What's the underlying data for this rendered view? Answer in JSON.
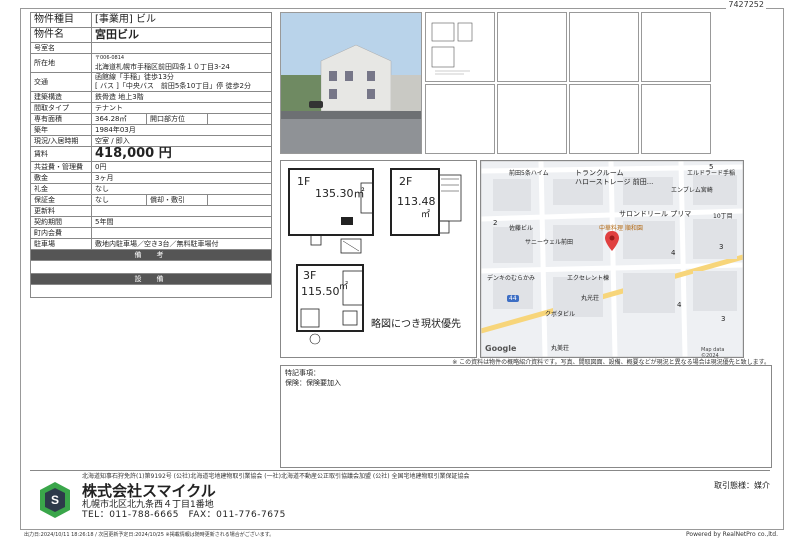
{
  "doc_id": "7427252",
  "property": {
    "type_label": "物件種目",
    "type_value": "[事業用] ビル",
    "name_label": "物件名",
    "name_value": "宮田ビル",
    "room_label": "号室名",
    "room_value": "",
    "location_label": "所在地",
    "postal": "〒006-0814",
    "address": "北海道札幌市手稲区前田四条１０丁目3-24",
    "traffic_label": "交通",
    "traffic_line1": "函館線「手稲」徒歩13分",
    "traffic_line2": "[ バス ]「中央バス　前田5条10丁目」停 徒歩2分",
    "structure_label": "建築構造",
    "structure_value": "鉄骨造 地上3階",
    "layout_label": "間取タイプ",
    "layout_value": "テナント",
    "area_label": "専有面積",
    "area_value": "364.28㎡",
    "opening_label": "開口部方位",
    "opening_value": "",
    "built_label": "築年",
    "built_value": "1984年03月",
    "status_label": "現況/入居時期",
    "status_value": "空室 / 即入",
    "rent_label": "賃料",
    "rent_value": "418,000 円",
    "common_label": "共益費・管理費",
    "common_value": "0円",
    "deposit_label": "敷金",
    "deposit_value": "3ヶ月",
    "key_label": "礼金",
    "key_value": "なし",
    "guarantee_label": "保証金",
    "guarantee_value": "なし",
    "amort_label": "償却・敷引",
    "amort_value": "",
    "renewal_label": "更新料",
    "renewal_value": "",
    "contract_label": "契約期間",
    "contract_value": "5年間",
    "town_label": "町内会費",
    "town_value": "",
    "parking_label": "駐車場",
    "parking_value": "敷地内駐車場／空き3台／無料駐車場付",
    "remarks_header": "備　考",
    "facilities_header": "設　備"
  },
  "floorplan": {
    "f1_label": "1F",
    "f1_area": "135.30㎡",
    "f2_label": "2F",
    "f2_area": "113.48",
    "f2_unit": "㎡",
    "f3_label": "3F",
    "f3_area": "115.50",
    "f3_unit": "㎡",
    "caption": "略図につき現状優先"
  },
  "map": {
    "labels": [
      "前田5条ハイム",
      "トランクルーム",
      "ハローストレージ 前田...",
      "エンブレム宮崎",
      "エルドラード手稲",
      "サロンドリール プリマ",
      "中華料理 順和園",
      "佐藤ビル",
      "サニーウェル前田",
      "デンキのむらかみ",
      "エクセレント棟",
      "丸光荘",
      "クボタビル",
      "丸美荘",
      "10丁目",
      "Google",
      "Map data ©2024"
    ],
    "numbers": [
      "5",
      "2",
      "4",
      "3",
      "4",
      "3"
    ],
    "route": "44"
  },
  "notice": "※ この資料は物件の概略紹介資料です。写真、間取図面、設備、概要などが現況と異なる場合は現況優先と致します。",
  "special": {
    "title": "特記事項：",
    "value": "保険：保険要加入"
  },
  "footer": {
    "assoc": "北海道知事石狩免許(1)第9192号 (公社)北海道宅地建物取引業協会 (一社)北海道不動産公正取引協議会加盟 (公社) 全国宅地建物取引業保証協会",
    "company": "株式会社スマイクル",
    "address": "札幌市北区北九条西４丁目1番地",
    "tel": "TEL：011-788-6665　FAX：011-776-7675",
    "agent": "取引態様：媒介",
    "print_info": "出力日:2024/10/11 18:26:18 / 次回更新予定日:2024/10/25 ※掲載情報は随時更新される場合がございます。",
    "powered": "Powered by RealNetPro co.,ltd."
  },
  "colors": {
    "header_bg": "#555555",
    "pin": "#e04040",
    "logo_green": "#3aa64a",
    "logo_dark": "#2d3a4a"
  }
}
